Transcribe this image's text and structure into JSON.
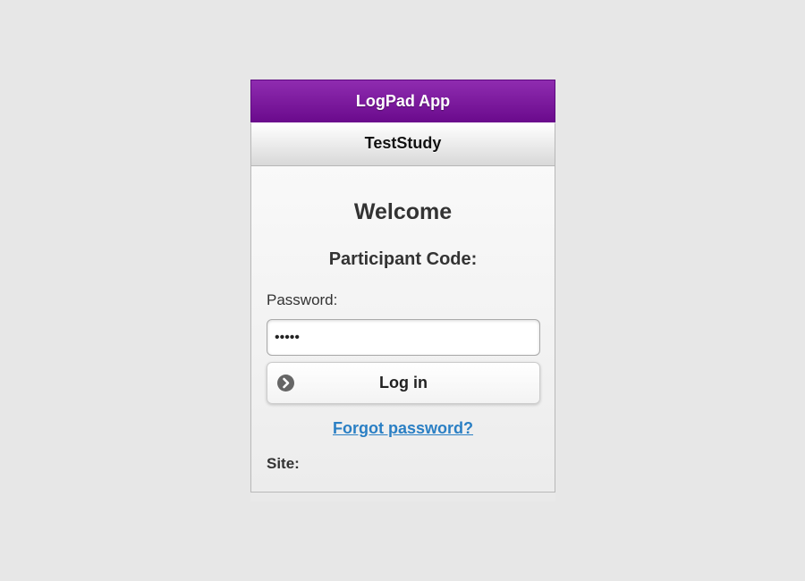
{
  "app": {
    "title": "LogPad App",
    "study": "TestStudy"
  },
  "login": {
    "welcome": "Welcome",
    "participant_label": "Participant Code:",
    "password_label": "Password:",
    "password_value": "•••••",
    "login_label": "Log in",
    "login_icon": "chevron-right-circle-icon",
    "forgot_label": "Forgot password?",
    "site_label": "Site:"
  },
  "colors": {
    "header": "#7a1a9c",
    "link": "#2a7fc4",
    "background": "#e7e7e7"
  }
}
